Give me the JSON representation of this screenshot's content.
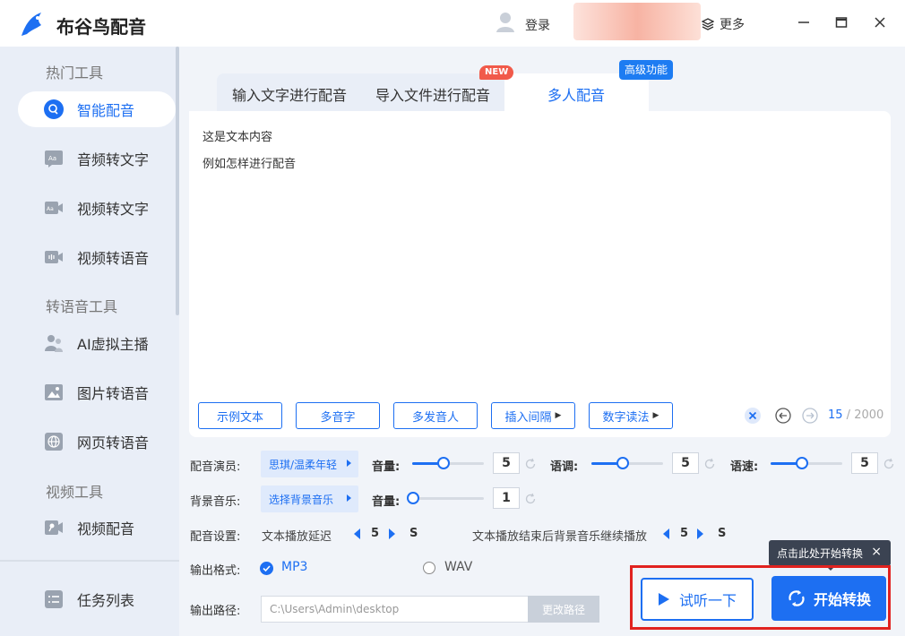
{
  "app": {
    "title": "布谷鸟配音"
  },
  "header": {
    "login": "登录",
    "more": "更多"
  },
  "sidebar": {
    "sections": [
      "热门工具",
      "转语音工具",
      "视频工具"
    ],
    "items": [
      {
        "label": "智能配音",
        "active": true
      },
      {
        "label": "音频转文字"
      },
      {
        "label": "视频转文字"
      },
      {
        "label": "视频转语音"
      },
      {
        "label": "AI虚拟主播"
      },
      {
        "label": "图片转语音"
      },
      {
        "label": "网页转语音"
      },
      {
        "label": "视频配音"
      },
      {
        "label": "任务列表"
      }
    ]
  },
  "tabs": [
    {
      "label": "输入文字进行配音"
    },
    {
      "label": "导入文件进行配音",
      "badge": "NEW"
    },
    {
      "label": "多人配音",
      "badge": "高级功能",
      "active": true
    }
  ],
  "editor": {
    "lines": [
      "这是文本内容",
      "例如怎样进行配音"
    ],
    "buttons": [
      "示例文本",
      "多音字",
      "多发音人",
      "插入间隔",
      "数字读法"
    ],
    "count": "15",
    "count_total": " / 2000"
  },
  "settings": {
    "voice_label": "配音演员:",
    "voice_value": "思琪/温柔年轻",
    "volume_label": "音量:",
    "volume": "5",
    "pitch_label": "语调:",
    "pitch": "5",
    "speed_label": "语速:",
    "speed": "5",
    "bgm_label": "背景音乐:",
    "bgm_value": "选择背景音乐",
    "bgm_volume_label": "音量:",
    "bgm_volume": "1",
    "setup_label": "配音设置:",
    "delay_label": "文本播放延迟",
    "delay_value": "5",
    "delay_unit": "S",
    "continue_label": "文本播放结束后背景音乐继续播放",
    "continue_value": "5",
    "continue_unit": "S",
    "format_label": "输出格式:",
    "format_mp3": "MP3",
    "format_wav": "WAV",
    "path_label": "输出路径:",
    "path_value": "C:\\Users\\Admin\\desktop",
    "path_button": "更改路径"
  },
  "actions": {
    "tooltip": "点击此处开始转换",
    "try_label": "试听一下",
    "start_label": "开始转换"
  },
  "colors": {
    "accent": "#1d6ff2",
    "highlight": "#e1221f"
  }
}
